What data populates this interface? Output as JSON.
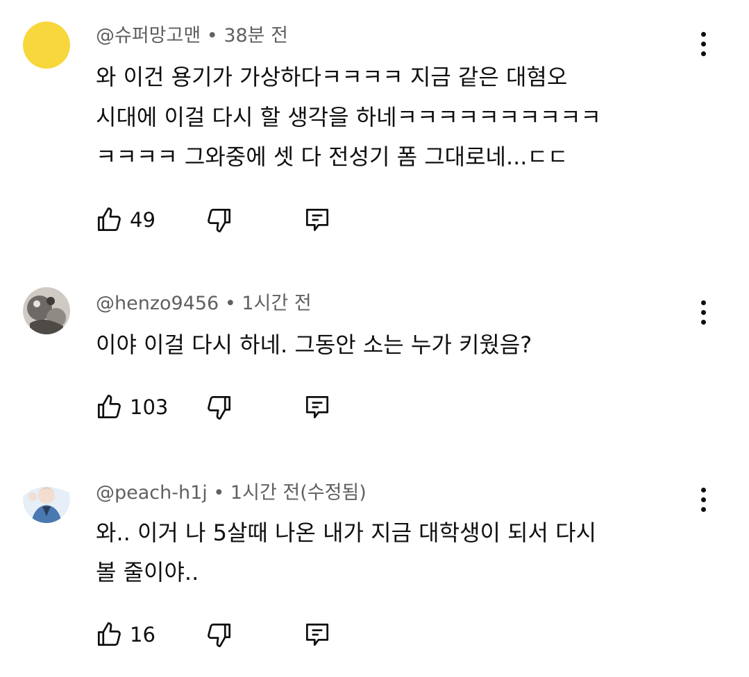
{
  "comments": [
    {
      "author": "@슈퍼망고맨",
      "separator": "•",
      "time": "38분 전",
      "lines": [
        "와 이건 용기가 가상하다ㅋㅋㅋㅋ 지금 같은 대혐오",
        "시대에 이걸 다시 할 생각을 하네ㅋㅋㅋㅋㅋㅋㅋㅋㅋㅋ",
        "ㅋㅋㅋㅋ 그와중에 셋 다 전성기 폼 그대로네...ㄷㄷ"
      ],
      "likes": "49",
      "avatar_color": "#f8d73c",
      "icons": [
        "like-icon",
        "dislike-icon",
        "reply-icon",
        "more-vert-icon"
      ]
    },
    {
      "author": "@henzo9456",
      "separator": "•",
      "time": "1시간 전",
      "lines": [
        "이야 이걸 다시 하네. 그동안 소는 누가 키웠음?"
      ],
      "likes": "103",
      "avatar_color": "#6d6a66",
      "icons": [
        "like-icon",
        "dislike-icon",
        "reply-icon",
        "more-vert-icon"
      ]
    },
    {
      "author": "@peach-h1j",
      "separator": "•",
      "time": "1시간 전(수정됨)",
      "lines": [
        "와.. 이거 나 5살때 나온 내가 지금 대학생이 되서 다시",
        "볼 줄이야.."
      ],
      "likes": "16",
      "avatar_color": "#4a78b0",
      "icons": [
        "like-icon",
        "dislike-icon",
        "reply-icon",
        "more-vert-icon"
      ]
    }
  ]
}
